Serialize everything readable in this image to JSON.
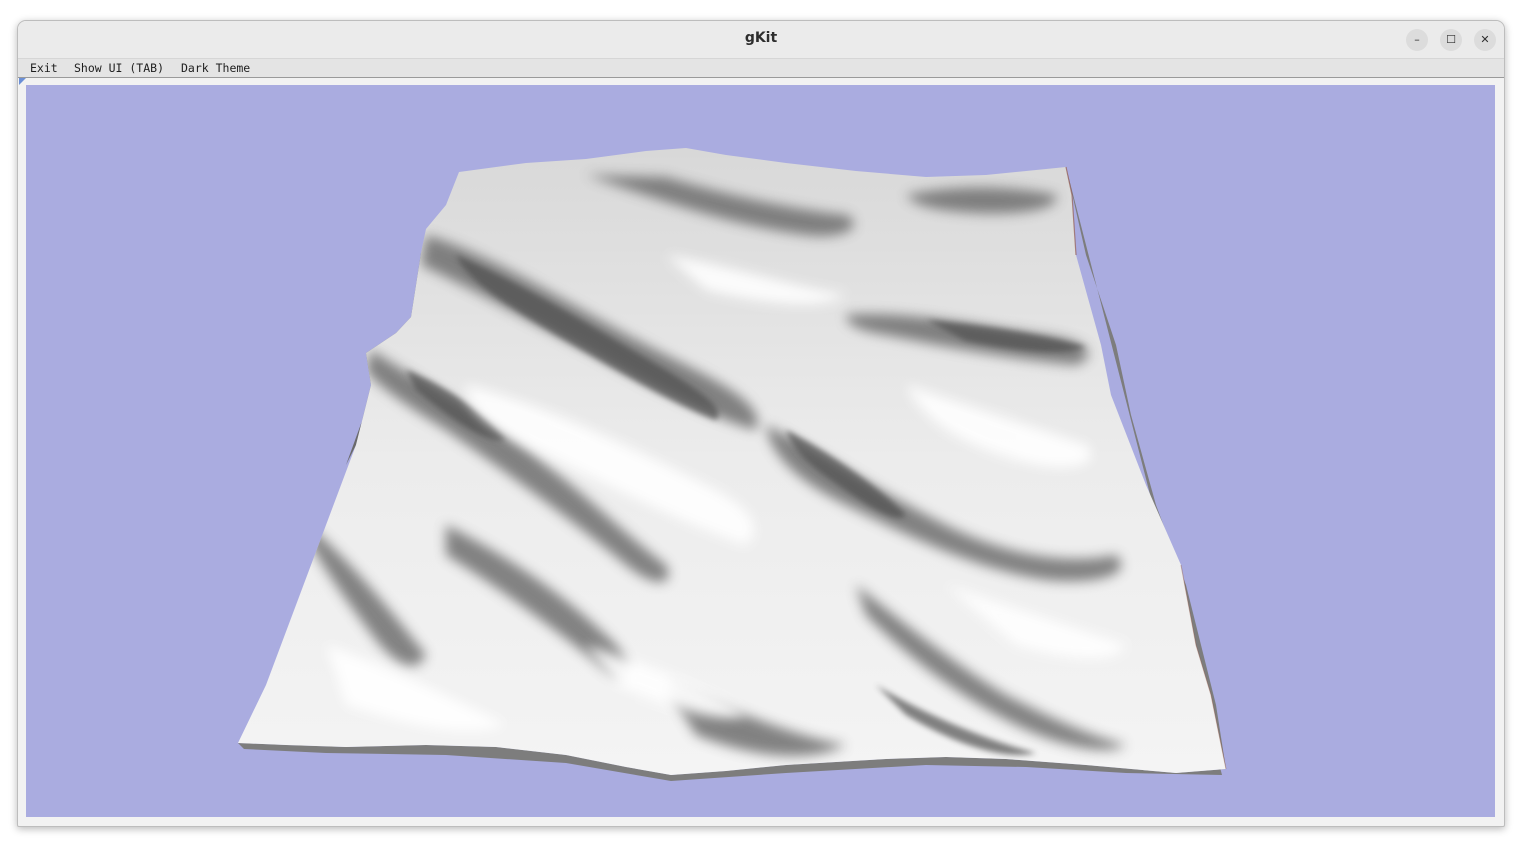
{
  "window": {
    "title": "gKit",
    "controls": {
      "minimize_icon": "minimize-icon",
      "maximize_icon": "maximize-icon",
      "close_icon": "close-icon",
      "minimize_glyph": "–",
      "maximize_glyph": "☐",
      "close_glyph": "✕"
    }
  },
  "menu": {
    "exit_label": "Exit",
    "show_ui_label": "Show UI (TAB)",
    "dark_theme_label": "Dark Theme"
  },
  "viewport": {
    "background_color": "#aaace0",
    "content": "terrain-mesh",
    "mesh_color": "#f0f0f0"
  }
}
